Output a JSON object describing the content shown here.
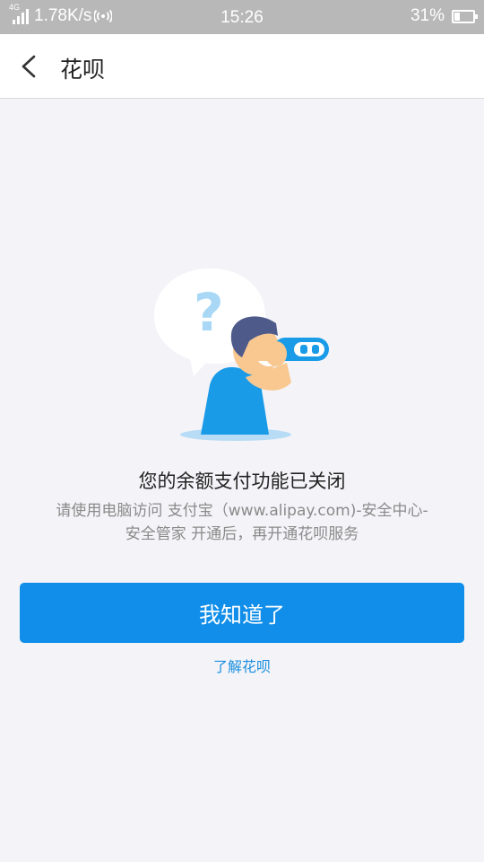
{
  "status_bar": {
    "network": "4G",
    "speed": "1.78K/s",
    "time": "15:26",
    "battery": "31%",
    "battery_level": 0.31
  },
  "nav": {
    "title": "花呗",
    "back_icon": "chevron-left-icon"
  },
  "illustration": {
    "question_mark": "?",
    "icon": "man-with-binoculars-illustration"
  },
  "content": {
    "headline": "您的余额支付功能已关闭",
    "description_line1": "请使用电脑访问 支付宝（www.alipay.com)-安全中心-",
    "description_line2": "安全管家 开通后，再开通花呗服务"
  },
  "actions": {
    "primary_label": "我知道了",
    "link_label": "了解花呗"
  },
  "colors": {
    "accent": "#108ee9",
    "link": "#1a8fe0",
    "status_bar_bg": "#b8b8b8",
    "page_bg": "#f4f4f8"
  }
}
